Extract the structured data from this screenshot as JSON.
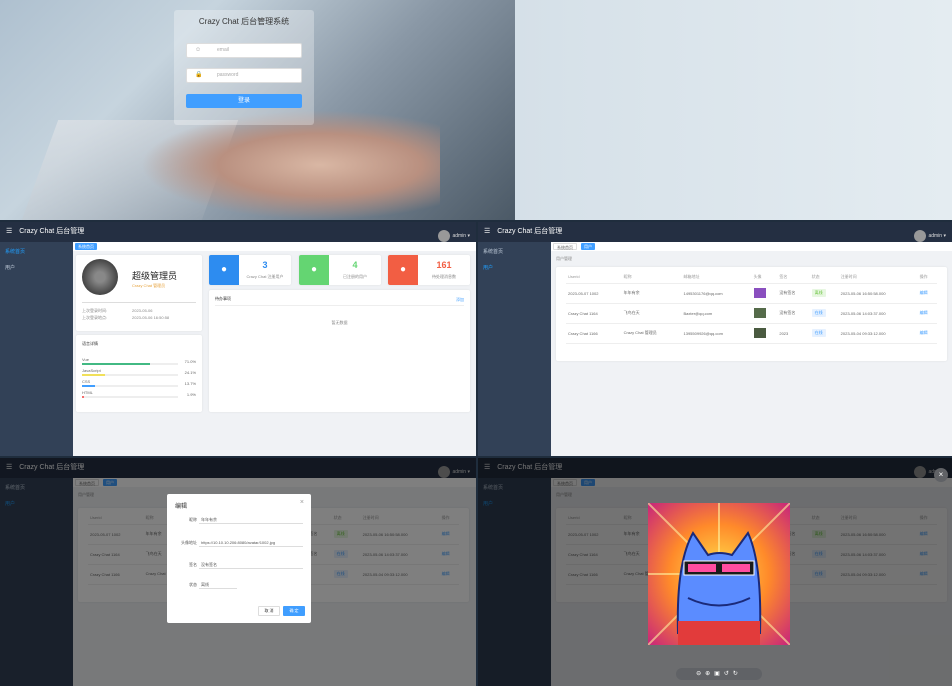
{
  "login": {
    "title": "Crazy Chat 后台管理系统",
    "email_placeholder": "email",
    "password_placeholder": "password",
    "submit_label": "登录"
  },
  "app": {
    "title": "Crazy Chat 后台管理",
    "username": "admin",
    "tab_home": "系统首页",
    "tab_users": "用户"
  },
  "sidebar": {
    "home_label": "系统首页",
    "users_label": "用户"
  },
  "dashboard": {
    "user_name": "超级管理员",
    "user_role": "Crazy Chat 管理员",
    "info_rows": [
      {
        "label": "上次登录时间:",
        "value": "2023-05-06"
      },
      {
        "label": "上次登录地点:",
        "value": "2023-05-06 16:50:58"
      }
    ],
    "lang_title": "语言详情",
    "langs": [
      {
        "name": "Vue",
        "pct": "71.0%",
        "value": 71.0,
        "color": "#42b983"
      },
      {
        "name": "JavaScript",
        "pct": "24.1%",
        "value": 24.1,
        "color": "#f1e05a"
      },
      {
        "name": "CSS",
        "pct": "13.7%",
        "value": 13.7,
        "color": "#409eff"
      },
      {
        "name": "HTML",
        "pct": "1.9%",
        "value": 1.9,
        "color": "#f56c6c"
      }
    ],
    "stats": [
      {
        "num": "3",
        "label": "Crazy Chat 注册用户",
        "color": "#2d8cf0"
      },
      {
        "num": "4",
        "label": "已注册的用户",
        "color": "#64d572"
      },
      {
        "num": "161",
        "label": "待处理消息数",
        "color": "#f25e43"
      }
    ],
    "todo_title": "待办事项",
    "todo_add": "添加",
    "todo_empty": "暂无数据"
  },
  "users_page": {
    "breadcrumb": "用户管理",
    "columns": [
      "Userid",
      "昵称",
      "邮箱地址",
      "头像",
      "签名",
      "状态",
      "注册时间",
      "操作"
    ],
    "rows": [
      {
        "id": "2023-05-07 1002",
        "nick": "年年有余",
        "email": "1495301176@qq.com",
        "sig": "没有签名",
        "status": "离线",
        "status_color": "green",
        "time": "2023-05-06 16:50:58.000",
        "action": "编辑",
        "thumb": "#8a4fbf"
      },
      {
        "id": "Crazy Chat 1164",
        "nick": "飞鸟在天",
        "email": "Baxter@qq.com",
        "sig": "没有签名",
        "status": "在线",
        "status_color": "blue",
        "time": "2023-05-06 14:03:37.000",
        "action": "编辑",
        "thumb": "#556b4a"
      },
      {
        "id": "Crazy Chat 1166",
        "nick": "Crazy Chat 管理员",
        "email": "1395509926@qq.com",
        "sig": "2023",
        "status": "在线",
        "status_color": "blue",
        "time": "2023-05-04 09:33:12.000",
        "action": "编辑",
        "thumb": "#4a5a40"
      }
    ]
  },
  "edit_dialog": {
    "title": "编辑",
    "fields": [
      {
        "label": "昵称",
        "value": "年年有余"
      },
      {
        "label": "头像地址",
        "value": "https://10.10.10.206:8080/avatar/1002.jpg"
      },
      {
        "label": "签名",
        "value": "没有签名"
      },
      {
        "label": "状态",
        "value": "离线"
      }
    ],
    "cancel": "取 消",
    "confirm": "确 定"
  },
  "preview": {
    "toolbar_icons": [
      "zoom-out-icon",
      "zoom-in-icon",
      "fullscreen-icon",
      "rotate-left-icon",
      "rotate-right-icon"
    ]
  }
}
